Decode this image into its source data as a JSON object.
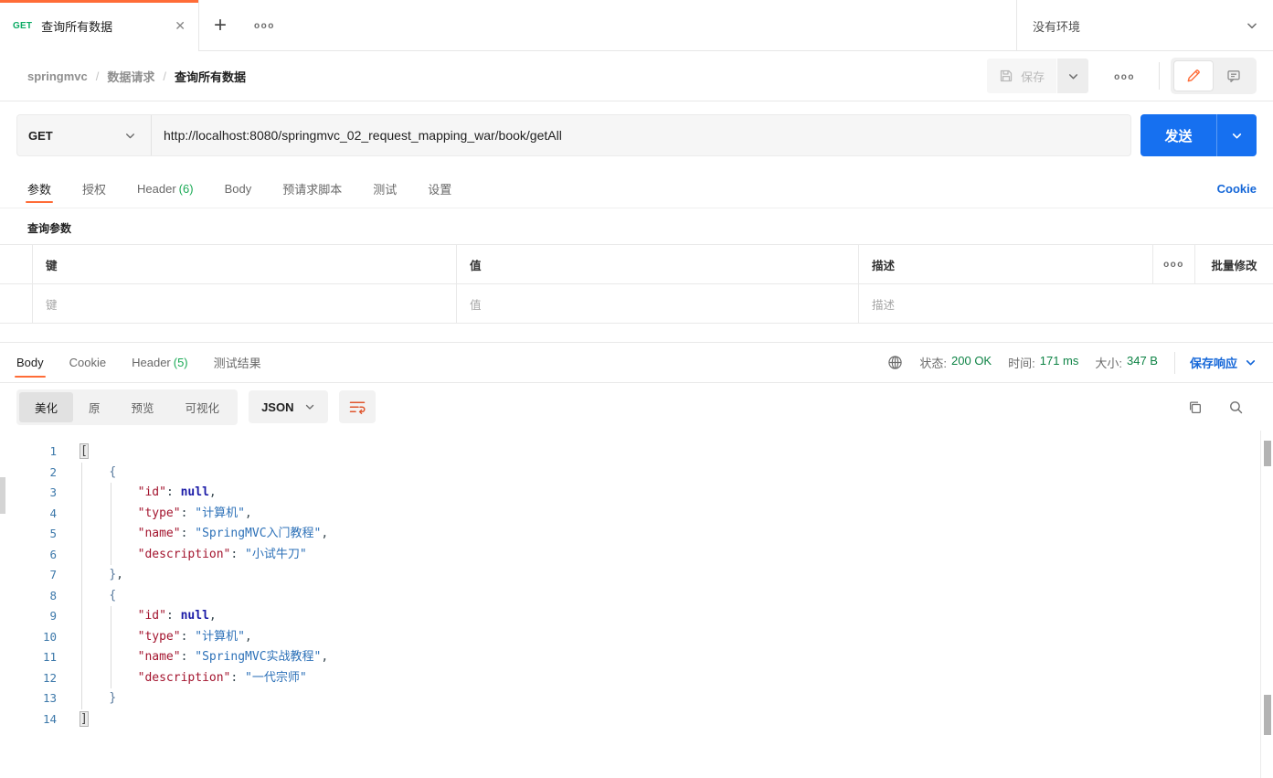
{
  "colors": {
    "accent": "#ff6c37",
    "send_blue": "#1670f0",
    "link_blue": "#1567d8",
    "method_green": "#0bab64",
    "status_green": "#0e8345"
  },
  "icons": {
    "close": "✕",
    "plus": "+",
    "more": "ooo"
  },
  "tabbar": {
    "tab_method": "GET",
    "tab_title": "查询所有数据",
    "environment": "没有环境"
  },
  "breadcrumb": {
    "items": [
      "springmvc",
      "数据请求",
      "查询所有数据"
    ],
    "separator": "/"
  },
  "actions": {
    "save_label": "保存"
  },
  "request": {
    "method": "GET",
    "url": "http://localhost:8080/springmvc_02_request_mapping_war/book/getAll",
    "send_label": "发送"
  },
  "request_tabs": {
    "items": [
      {
        "name": "params",
        "label": "参数",
        "active": true
      },
      {
        "name": "auth",
        "label": "授权"
      },
      {
        "name": "headers",
        "label": "Header",
        "count": "(6)"
      },
      {
        "name": "body",
        "label": "Body"
      },
      {
        "name": "prerequest",
        "label": "预请求脚本"
      },
      {
        "name": "tests",
        "label": "测试"
      },
      {
        "name": "settings",
        "label": "设置"
      }
    ],
    "cookie_label": "Cookie"
  },
  "params": {
    "title": "查询参数",
    "columns": [
      "键",
      "值",
      "描述"
    ],
    "placeholders": [
      "键",
      "值",
      "描述"
    ],
    "bulk_edit_label": "批量修改"
  },
  "response": {
    "tabs": [
      {
        "name": "body",
        "label": "Body",
        "active": true
      },
      {
        "name": "cookie",
        "label": "Cookie"
      },
      {
        "name": "headers",
        "label": "Header",
        "count": "(5)"
      },
      {
        "name": "test-results",
        "label": "测试结果"
      }
    ],
    "status_label": "状态:",
    "status_value": "200 OK",
    "time_label": "时间:",
    "time_value": "171 ms",
    "size_label": "大小:",
    "size_value": "347 B",
    "save_response_label": "保存响应"
  },
  "response_toolbar": {
    "views": [
      {
        "name": "pretty",
        "label": "美化",
        "active": true
      },
      {
        "name": "raw",
        "label": "原"
      },
      {
        "name": "preview",
        "label": "预览"
      },
      {
        "name": "visualize",
        "label": "可视化"
      }
    ],
    "format": "JSON"
  },
  "code": {
    "lines": [
      [
        [
          "brk",
          "["
        ]
      ],
      [
        [
          "pl",
          "    "
        ],
        [
          "brace",
          "{"
        ]
      ],
      [
        [
          "pl",
          "        "
        ],
        [
          "key",
          "\"id\""
        ],
        [
          "pun",
          ": "
        ],
        [
          "kw",
          "null"
        ],
        [
          "pun",
          ","
        ]
      ],
      [
        [
          "pl",
          "        "
        ],
        [
          "key",
          "\"type\""
        ],
        [
          "pun",
          ": "
        ],
        [
          "str",
          "\"计算机\""
        ],
        [
          "pun",
          ","
        ]
      ],
      [
        [
          "pl",
          "        "
        ],
        [
          "key",
          "\"name\""
        ],
        [
          "pun",
          ": "
        ],
        [
          "str",
          "\"SpringMVC入门教程\""
        ],
        [
          "pun",
          ","
        ]
      ],
      [
        [
          "pl",
          "        "
        ],
        [
          "key",
          "\"description\""
        ],
        [
          "pun",
          ": "
        ],
        [
          "str",
          "\"小试牛刀\""
        ]
      ],
      [
        [
          "pl",
          "    "
        ],
        [
          "brace",
          "}"
        ],
        [
          "pun",
          ","
        ]
      ],
      [
        [
          "pl",
          "    "
        ],
        [
          "brace",
          "{"
        ]
      ],
      [
        [
          "pl",
          "        "
        ],
        [
          "key",
          "\"id\""
        ],
        [
          "pun",
          ": "
        ],
        [
          "kw",
          "null"
        ],
        [
          "pun",
          ","
        ]
      ],
      [
        [
          "pl",
          "        "
        ],
        [
          "key",
          "\"type\""
        ],
        [
          "pun",
          ": "
        ],
        [
          "str",
          "\"计算机\""
        ],
        [
          "pun",
          ","
        ]
      ],
      [
        [
          "pl",
          "        "
        ],
        [
          "key",
          "\"name\""
        ],
        [
          "pun",
          ": "
        ],
        [
          "str",
          "\"SpringMVC实战教程\""
        ],
        [
          "pun",
          ","
        ]
      ],
      [
        [
          "pl",
          "        "
        ],
        [
          "key",
          "\"description\""
        ],
        [
          "pun",
          ": "
        ],
        [
          "str",
          "\"一代宗师\""
        ]
      ],
      [
        [
          "pl",
          "    "
        ],
        [
          "brace",
          "}"
        ]
      ],
      [
        [
          "brk",
          "]"
        ]
      ]
    ]
  }
}
